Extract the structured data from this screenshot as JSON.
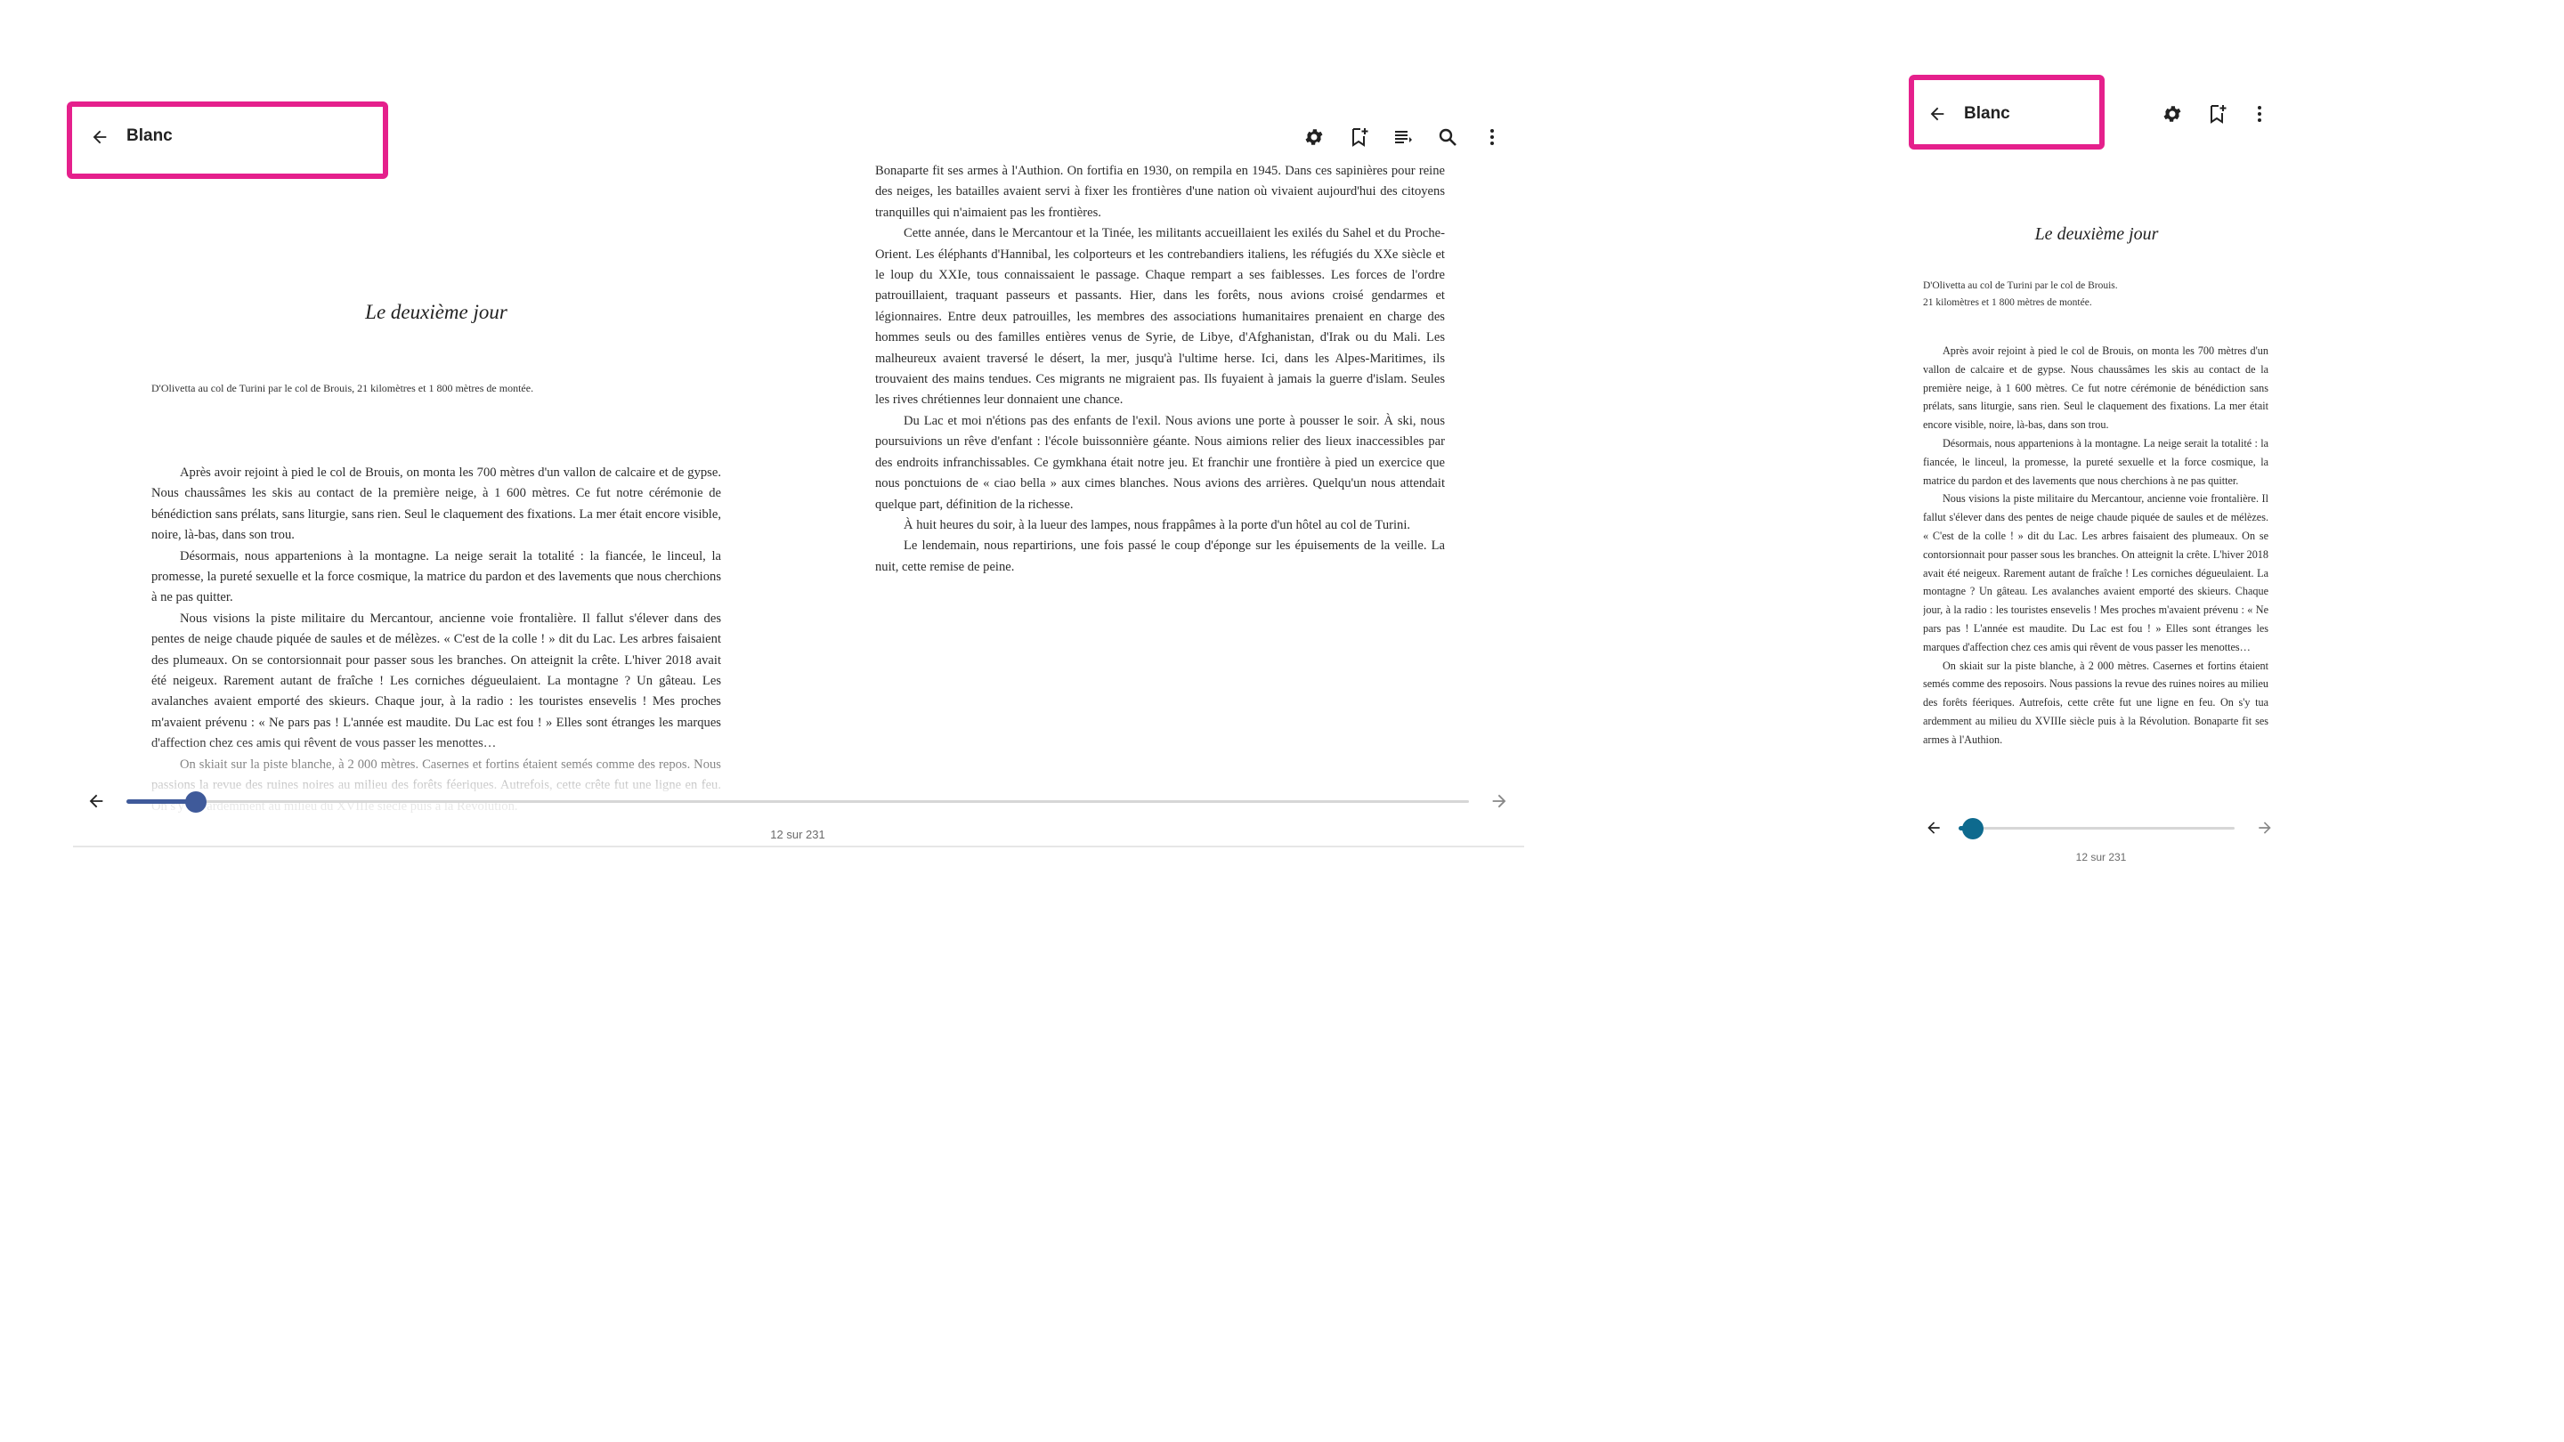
{
  "wide_view": {
    "header": {
      "back_icon": "arrow-left-icon",
      "title": "Blanc",
      "toolbar_icons": [
        "settings-gear-icon",
        "bookmark-add-icon",
        "table-of-contents-icon",
        "search-icon",
        "more-vertical-icon"
      ]
    },
    "chapter": {
      "title": "Le deuxième jour",
      "subtitle": "D'Olivetta au col de Turini par le col de Brouis, 21 kilomètres et 1 800 mètres de montée."
    },
    "left_page": {
      "paragraphs": [
        "Après avoir rejoint à pied le col de Brouis, on monta les 700 mètres d'un vallon de calcaire et de gypse. Nous chaussâmes les skis au contact de la première neige, à 1 600 mètres. Ce fut notre cérémonie de bénédiction sans prélats, sans liturgie, sans rien. Seul le claquement des fixations. La mer était encore visible, noire, là-bas, dans son trou.",
        "Désormais, nous appartenions à la montagne. La neige serait la totalité : la fiancée, le linceul, la promesse, la pureté sexuelle et la force cosmique, la matrice du pardon et des lavements que nous cherchions à ne pas quitter.",
        "Nous visions la piste militaire du Mercantour, ancienne voie frontalière. Il fallut s'élever dans des pentes de neige chaude piquée de saules et de mélèzes. « C'est de la colle ! » dit du Lac. Les arbres faisaient des plumeaux. On se contorsionnait pour passer sous les branches. On atteignit la crête. L'hiver 2018 avait été neigeux. Rarement autant de fraîche ! Les corniches dégueulaient. La montagne ? Un gâteau. Les avalanches avaient emporté des skieurs. Chaque jour, à la radio : les touristes ensevelis ! Mes proches m'avaient prévenu : « Ne pars pas ! L'année est maudite. Du Lac est fou ! » Elles sont étranges les marques d'affection chez ces amis qui rêvent de vous passer les menottes…",
        "On skiait sur la piste blanche, à 2 000 mètres. Casernes et fortins étaient semés comme des repos. Nous passions la revue des ruines noires au milieu des forêts féeriques. Autrefois, cette crête fut une ligne en feu. On s'y tua ardemment au milieu du XVIIIe siècle puis à la Révolution."
      ]
    },
    "right_page": {
      "paragraphs": [
        "Bonaparte fit ses armes à l'Authion. On fortifia en 1930, on rempila en 1945. Dans ces sapinières pour reine des neiges, les batailles avaient servi à fixer les frontières d'une nation où vivaient aujourd'hui des citoyens tranquilles qui n'aimaient pas les frontières.",
        "Cette année, dans le Mercantour et la Tinée, les militants accueillaient les exilés du Sahel et du Proche-Orient. Les éléphants d'Hannibal, les colporteurs et les contrebandiers italiens, les réfugiés du XXe siècle et le loup du XXIe, tous connaissaient le passage. Chaque rempart a ses faiblesses. Les forces de l'ordre patrouillaient, traquant passeurs et passants. Hier, dans les forêts, nous avions croisé gendarmes et légionnaires. Entre deux patrouilles, les membres des associations humanitaires prenaient en charge des hommes seuls ou des familles entières venus de Syrie, de Libye, d'Afghanistan, d'Irak ou du Mali. Les malheureux avaient traversé le désert, la mer, jusqu'à l'ultime herse. Ici, dans les Alpes-Maritimes, ils trouvaient des mains tendues. Ces migrants ne migraient pas. Ils fuyaient à jamais la guerre d'islam. Seules les rives chrétiennes leur donnaient une chance.",
        "Du Lac et moi n'étions pas des enfants de l'exil. Nous avions une porte à pousser le soir. À ski, nous poursuivions un rêve d'enfant : l'école buissonnière géante. Nous aimions relier des lieux inaccessibles par des endroits infranchissables. Ce gymkhana était notre jeu. Et franchir une frontière à pied un exercice que nous ponctuions de « ciao bella » aux cimes blanches. Nous avions des arrières. Quelqu'un nous attendait quelque part, définition de la richesse.",
        "À huit heures du soir, à la lueur des lampes, nous frappâmes à la porte d'un hôtel au col de Turini.",
        "Le lendemain, nous repartirions, une fois passé le coup d'éponge sur les épuisements de la veille. La nuit, cette remise de peine."
      ]
    },
    "footer": {
      "prev_icon": "arrow-left-icon",
      "next_icon": "arrow-right-icon",
      "progress_fraction": 0.052,
      "page_label": "12 sur 231"
    }
  },
  "narrow_view": {
    "header": {
      "back_icon": "arrow-left-icon",
      "title": "Blanc",
      "toolbar_icons": [
        "settings-gear-icon",
        "bookmark-add-icon",
        "more-vertical-icon"
      ]
    },
    "chapter": {
      "title": "Le deuxième jour",
      "subtitle_line1": "D'Olivetta au col de Turini par le col de Brouis.",
      "subtitle_line2": "21 kilomètres et 1 800 mètres de montée."
    },
    "page": {
      "paragraphs": [
        "Après avoir rejoint à pied le col de Brouis, on monta les 700 mètres d'un vallon de calcaire et de gypse. Nous chaussâmes les skis au contact de la première neige, à 1 600 mètres. Ce fut notre cérémonie de bénédiction sans prélats, sans liturgie, sans rien. Seul le claquement des fixations. La mer était encore visible, noire, là-bas, dans son trou.",
        "Désormais, nous appartenions à la montagne. La neige serait la totalité : la fiancée, le linceul, la promesse, la pureté sexuelle et la force cosmique, la matrice du pardon et des lavements que nous cherchions à ne pas quitter.",
        "Nous visions la piste militaire du Mercantour, ancienne voie frontalière. Il fallut s'élever dans des pentes de neige chaude piquée de saules et de mélèzes. « C'est de la colle ! » dit du Lac. Les arbres faisaient des plumeaux. On se contorsionnait pour passer sous les branches. On atteignit la crête. L'hiver 2018 avait été neigeux. Rarement autant de fraîche ! Les corniches dégueulaient. La montagne ? Un gâteau. Les avalanches avaient emporté des skieurs. Chaque jour, à la radio : les touristes ensevelis ! Mes proches m'avaient prévenu : « Ne pars pas ! L'année est maudite. Du Lac est fou ! » Elles sont étranges les marques d'affection chez ces amis qui rêvent de vous passer les menottes…",
        "On skiait sur la piste blanche, à 2 000 mètres. Casernes et fortins étaient semés comme des reposoirs. Nous passions la revue des ruines noires au milieu des forêts féeriques. Autrefois, cette crête fut une ligne en feu. On s'y tua ardemment au milieu du XVIIIe siècle puis à la Révolution. Bonaparte fit ses armes à l'Authion."
      ]
    },
    "footer": {
      "prev_icon": "arrow-left-icon",
      "next_icon": "arrow-right-icon",
      "progress_fraction": 0.052,
      "page_label": "12 sur 231"
    }
  },
  "colors": {
    "highlight": "#e5208c",
    "wide_slider": "#3f5a9a",
    "narrow_slider": "#0e6a8e",
    "text": "#2b2b2b"
  }
}
